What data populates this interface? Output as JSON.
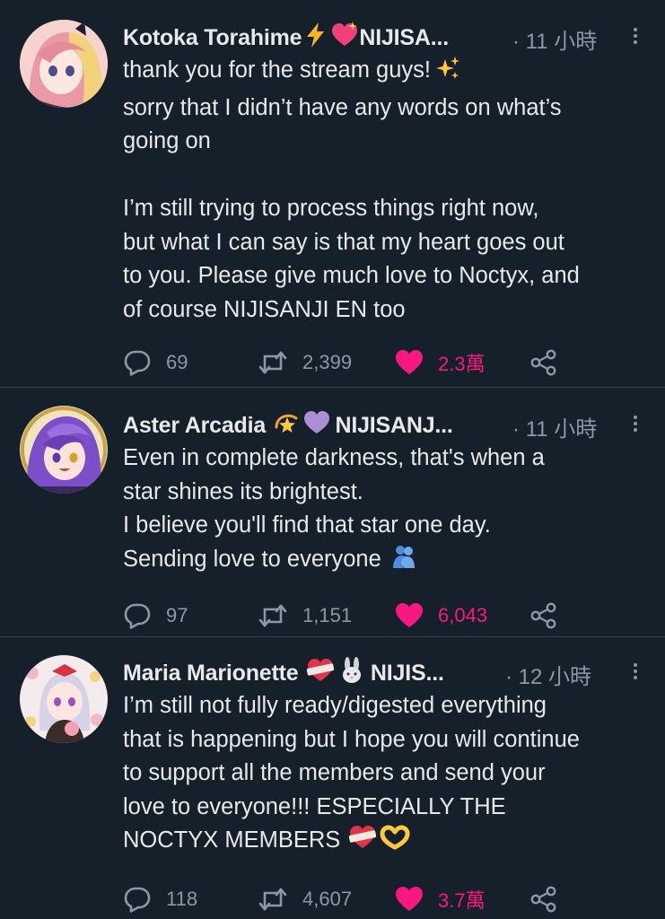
{
  "tweets": [
    {
      "name": "Kotoka Torahime",
      "name_suffix": "NIJISA...",
      "emoji_after_name": [
        "lightning-emoji",
        "sparkling-heart-emoji"
      ],
      "time": "· 11 小時",
      "lines": [
        "thank you for the stream guys!",
        "sorry that I didn’t have any words on what’s",
        "going on",
        "",
        "I’m still trying to process things right now,",
        "but what I can say is that my heart goes out",
        "to you. Please give much love to Noctyx, and",
        "of course NIJISANJI EN too"
      ],
      "replies": "69",
      "retweets": "2,399",
      "likes": "2.3萬"
    },
    {
      "name": "Aster Arcadia",
      "name_suffix": "NIJISANJ...",
      "emoji_after_name": [
        "dizzy-star-emoji",
        "purple-heart-emoji"
      ],
      "time": "· 11 小時",
      "lines": [
        "Even in complete darkness, that's when a",
        "star shines its brightest.",
        "I believe you'll find that star one day.",
        "Sending love to everyone"
      ],
      "replies": "97",
      "retweets": "1,151",
      "likes": "6,043"
    },
    {
      "name": "Maria Marionette",
      "name_suffix": "NIJIS...",
      "emoji_after_name": [
        "mending-heart-emoji",
        "rabbit-emoji"
      ],
      "time": "· 12 小時",
      "lines": [
        "I’m still not fully ready/digested everything",
        "that is happening but I hope you will continue",
        "to support all the members and send your",
        "love to everyone!!! ESPECIALLY THE",
        "NOCTYX MEMBERS"
      ],
      "replies": "118",
      "retweets": "4,607",
      "likes": "3.7萬"
    }
  ],
  "colors": {
    "background": "#15202b",
    "text": "#e7e9ea",
    "muted": "#8b98a5",
    "like": "#f91880",
    "divider": "#38444d"
  }
}
